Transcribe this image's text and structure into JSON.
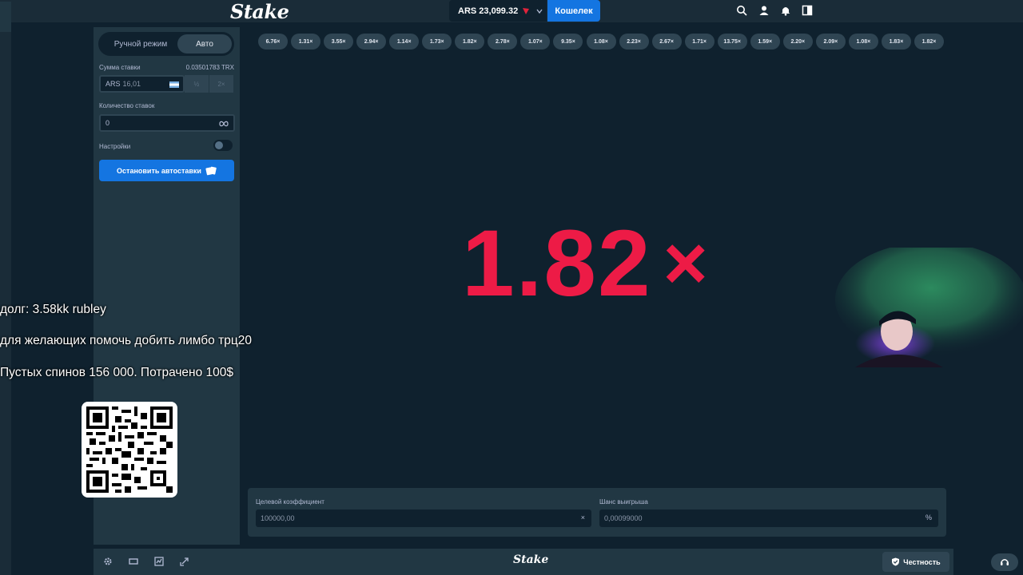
{
  "header": {
    "logo": "Stake",
    "balance": "ARS 23,099.32",
    "wallet_button": "Кошелек",
    "icons": [
      "search-icon",
      "user-icon",
      "bell-icon",
      "sidebar-toggle-icon"
    ]
  },
  "sidebar": {
    "tab_manual": "Ручной режим",
    "tab_auto": "Авто",
    "bet_amount_label": "Сумма ставки",
    "bet_amount_crypto": "0.03501783 TRX",
    "bet_currency": "ARS",
    "bet_amount": "16,01",
    "half_label": "½",
    "double_label": "2×",
    "bet_count_label": "Количество ставок",
    "bet_count_value": "0",
    "settings_label": "Настройки",
    "stop_autobet_button": "Остановить автоставки"
  },
  "history": [
    "6.76×",
    "1.31×",
    "3.55×",
    "2.94×",
    "1.14×",
    "1.73×",
    "1.82×",
    "2.78×",
    "1.07×",
    "9.35×",
    "1.08×",
    "2.23×",
    "2.67×",
    "1.71×",
    "13.75×",
    "1.59×",
    "2.20×",
    "2.09×",
    "1.08×",
    "1.83×",
    "1.82×"
  ],
  "result": {
    "multiplier": "1.82",
    "suffix": "×",
    "color": "#ed1b46"
  },
  "controls": {
    "target_label": "Целевой коэффициент",
    "target_value": "100000,00",
    "target_suffix": "×",
    "chance_label": "Шанс выигрыша",
    "chance_value": "0,00099000",
    "chance_suffix": "%"
  },
  "footer": {
    "logo": "Stake",
    "fairness_button": "Честность",
    "icons": [
      "settings-icon",
      "theatre-mode-icon",
      "stats-icon",
      "popout-icon"
    ]
  },
  "overlay": {
    "line1": "долг: 3.58kk rubley",
    "line2": "для желающих помочь добить лимбо трц20",
    "line3": "Пустых спинов 156 000. Потрачено 100$"
  },
  "colors": {
    "background": "#0f212e",
    "panel": "#213743",
    "accent": "#1475e1"
  }
}
